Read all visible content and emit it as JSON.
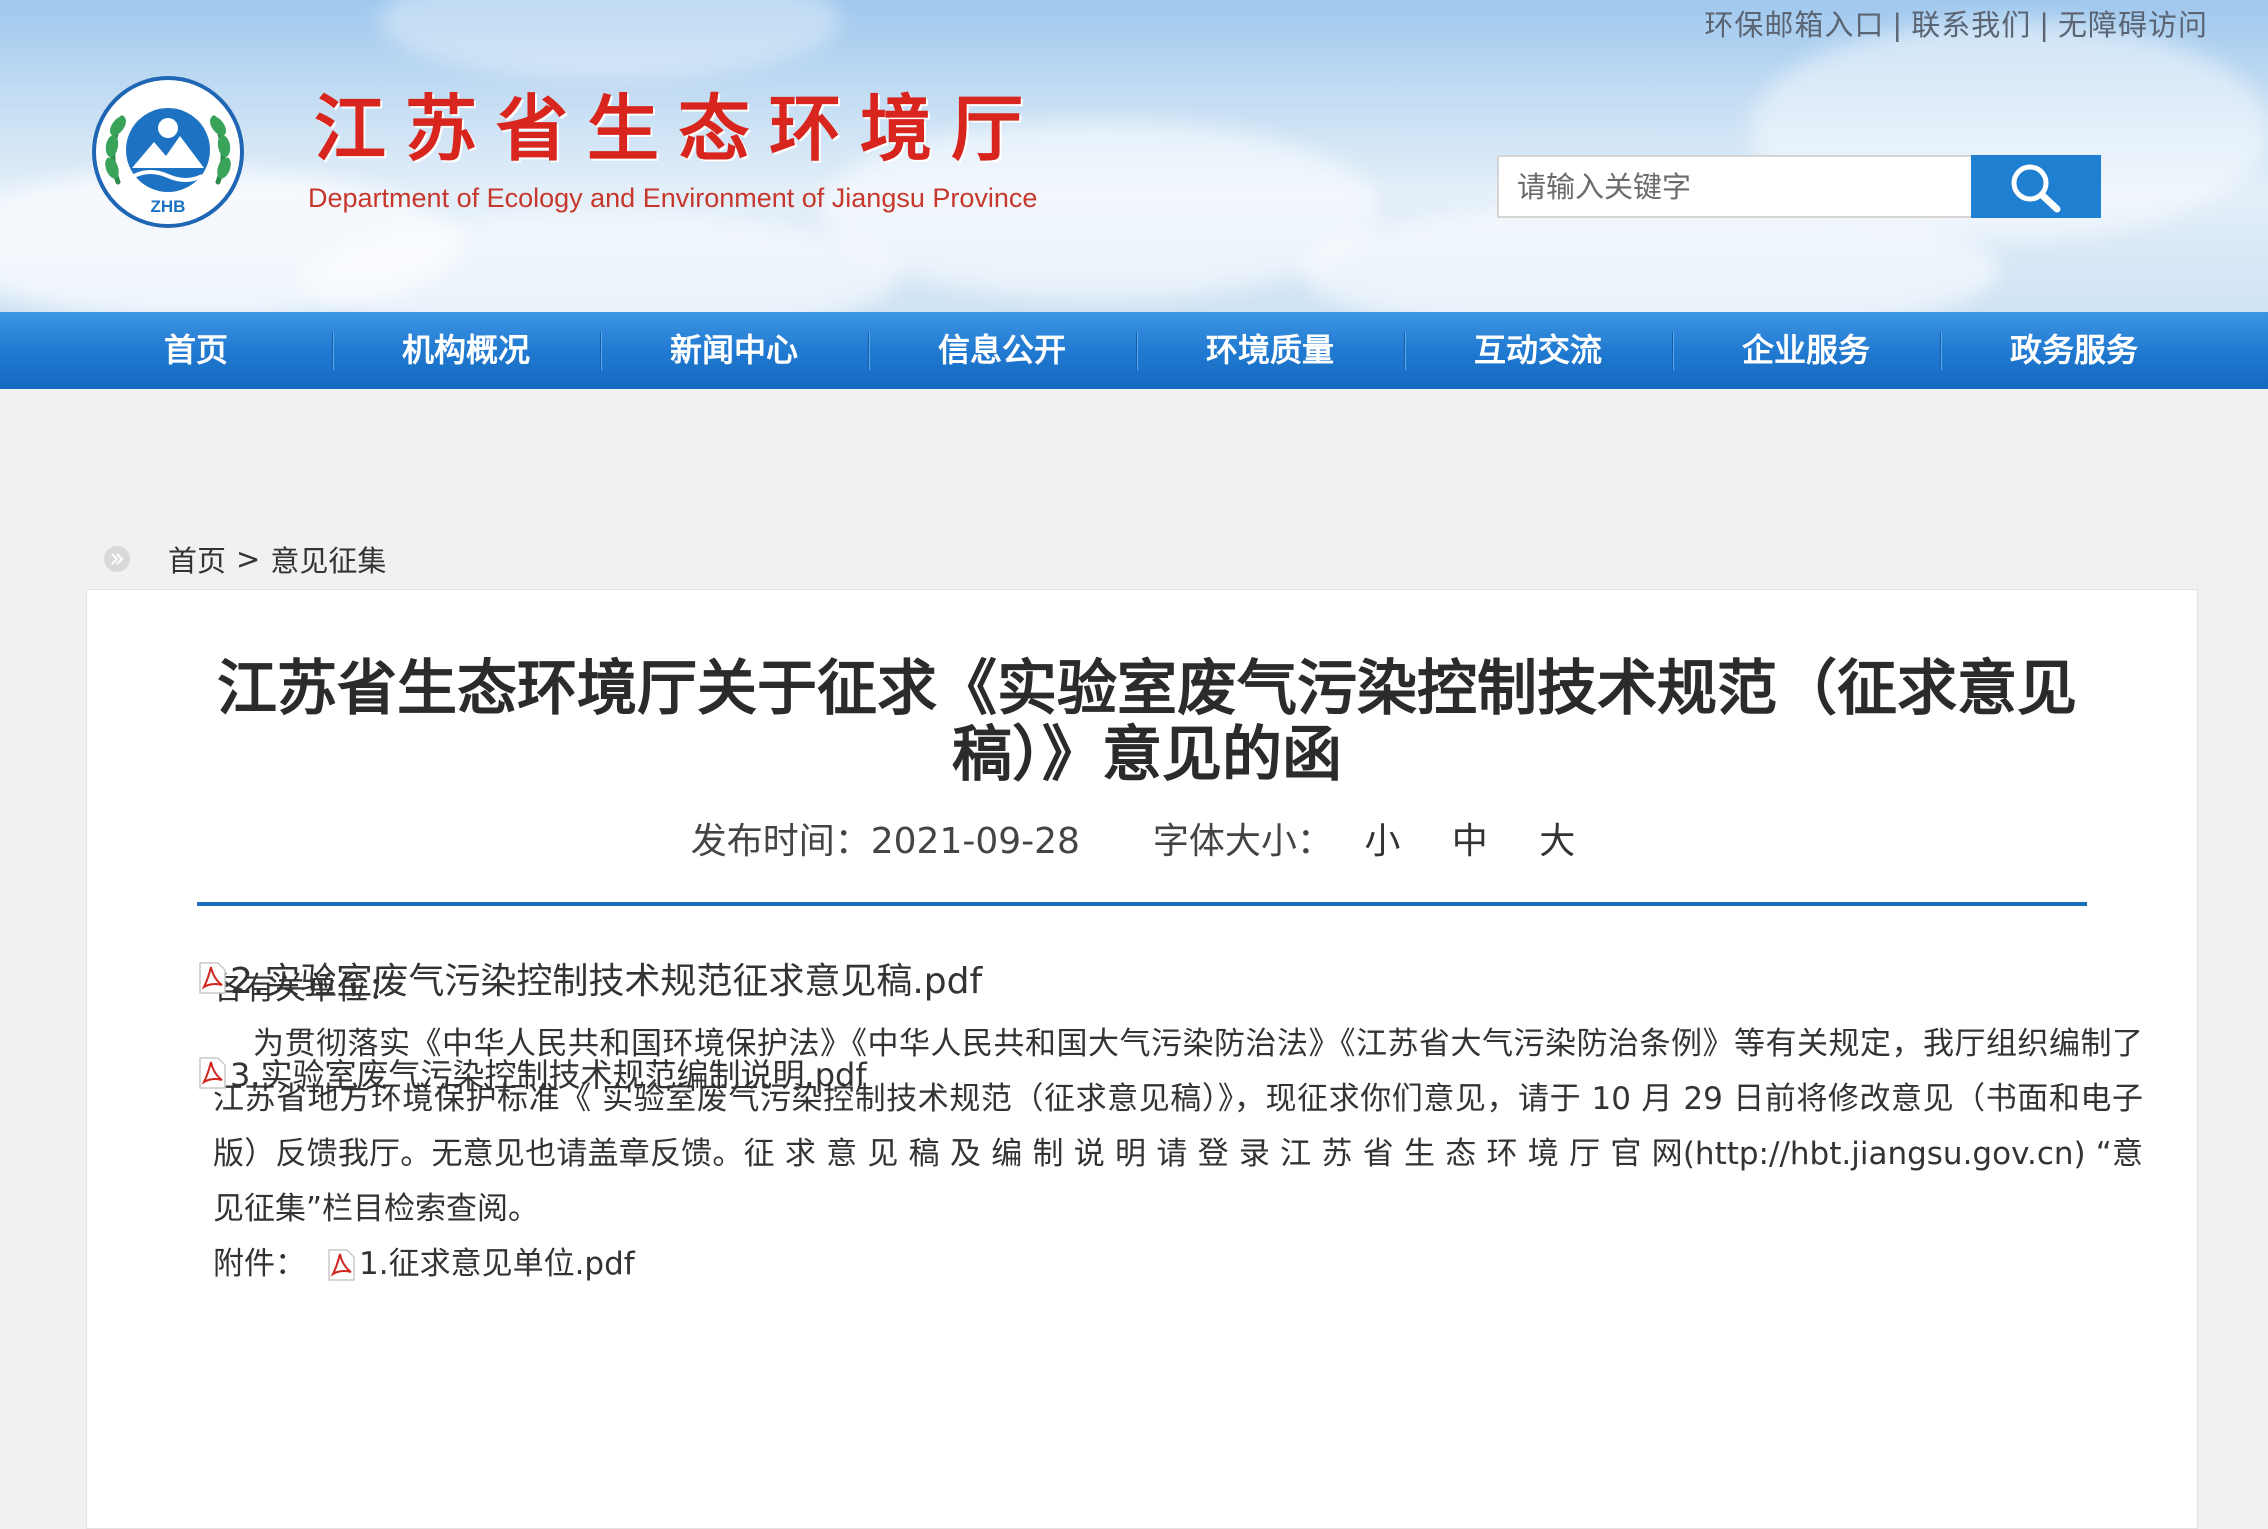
{
  "header": {
    "top_links": [
      "环保邮箱入口",
      "联系我们",
      "无障碍访问"
    ],
    "top_link_separator": "|",
    "site_title": "江苏省生态环境厅",
    "site_subtitle": "Department of Ecology and Environment of Jiangsu Province",
    "emblem_text": "ZHB",
    "search_placeholder": "请输入关键字"
  },
  "nav": {
    "items": [
      "首页",
      "机构概况",
      "新闻中心",
      "信息公开",
      "环境质量",
      "互动交流",
      "企业服务",
      "政务服务"
    ]
  },
  "breadcrumb": {
    "home": "首页",
    "separator": ">",
    "current": "意见征集"
  },
  "article": {
    "title": "江苏省生态环境厅关于征求《实验室废气污染控制技术规范（征求意见稿）》意见的函",
    "publish_label": "发布时间：",
    "publish_date": "2021-09-28",
    "font_size_label": "字体大小：",
    "font_sizes": [
      "小",
      "中",
      "大"
    ],
    "salutation": "各有关单位：",
    "body": "为贯彻落实《中华人民共和国环境保护法》《中华人民共和国大气污染防治法》《江苏省大气污染防治条例》等有关规定，我厅组织编制了江苏省地方环境保护标准《 实验室废气污染控制技术规范（征求意见稿）》，现征求你们意见，请于 10 月 29 日前将修改意见（书面和电子版）反馈我厅。无意见也请盖章反馈。征 求 意 见 稿 及 编 制 说 明 请 登 录 江 苏 省 生 态 环 境 厅 官 网(http://hbt.jiangsu.gov.cn) “意见征集”栏目检索查阅。",
    "attachments_label": "附件：",
    "attachments": [
      "1.征求意见单位.pdf",
      "2.实验室废气污染控制技术规范征求意见稿.pdf",
      "3.实验室废气污染控制技术规范编制说明.pdf"
    ]
  },
  "colors": {
    "title_red": "#d8261e",
    "nav_blue": "#1f78cf",
    "rule_blue": "#1b6fc0",
    "search_button": "#1f7fd1"
  }
}
